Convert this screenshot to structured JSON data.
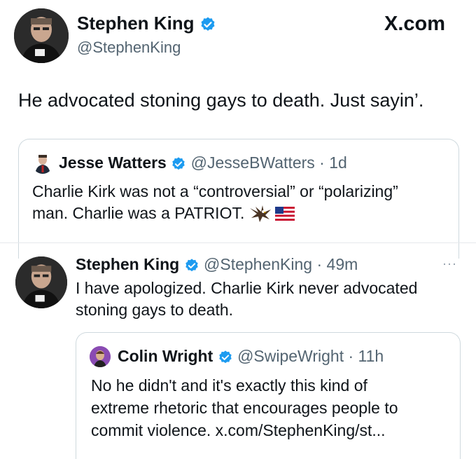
{
  "top": {
    "author": "Stephen King",
    "handle": "@StephenKing",
    "site": "X.com",
    "text": "He advocated stoning gays to death. Just sayin’."
  },
  "quote1": {
    "author": "Jesse Watters",
    "handle": "@JesseBWatters",
    "time": "1d",
    "line1": "Charlie Kirk was not a “controversial” or “polarizing”",
    "line2": "man. Charlie was a PATRIOT."
  },
  "reply": {
    "author": "Stephen King",
    "handle": "@StephenKing",
    "time": "49m",
    "more": "···",
    "line1": "I have apologized. Charlie Kirk never advocated",
    "line2": "stoning gays to death."
  },
  "quote2": {
    "author": "Colin Wright",
    "handle": "@SwipeWright",
    "time": "11h",
    "line1": "No he didn't and it's exactly this kind of",
    "line2": "extreme rhetoric that encourages people to",
    "line3": "commit violence. x.com/StephenKing/st..."
  },
  "separator": " · ",
  "colors": {
    "verified": "#1d9bf0",
    "text": "#0f1419",
    "secondary": "#536471",
    "border": "#cfd9de"
  }
}
